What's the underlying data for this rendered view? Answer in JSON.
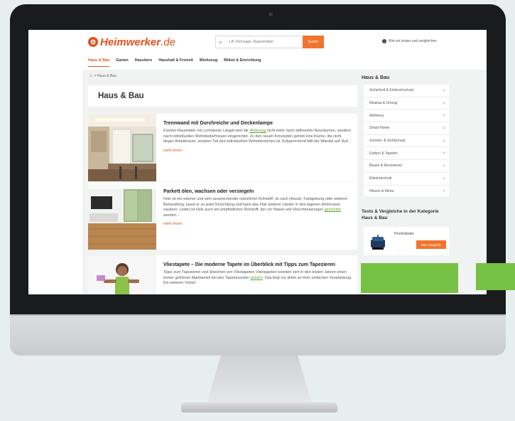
{
  "brand": {
    "name": "Heimwerker",
    "domain": ".de"
  },
  "search": {
    "placeholder": "z.B. Kiichsage, Rasenmäher",
    "button_label": "Suche"
  },
  "header_link": "Wie wir testen und vergleichen",
  "nav": [
    "Haus & Bau",
    "Garten",
    "Haustiere",
    "Haushalt & Freizeit",
    "Werkzeug",
    "Möbel & Einrichtung"
  ],
  "breadcrumb": "> Haus & Bau",
  "page_title": "Haus & Bau",
  "articles": [
    {
      "title": "Trennwand mit Durchreiche und Deckenlampe",
      "excerpt_before": "Küchen-Raumteiler mit Lichtdecke Längst wird die ",
      "excerpt_link": "Wohnung",
      "excerpt_after": " nicht mehr nach definierten Nutzräumen, sondern nach individuellen Wohnbedürfnissen eingerichtet. Zu den neuen Konzepten gehört eine Küche, die nicht länger Arbeitsraum, sondern Teil des individuellen Wohnbereiches ist. Entsprechend fällt der Wandel auf: Auf...",
      "more": "mehr lesen"
    },
    {
      "title": "Parkett ölen, wachsen oder versiegeln",
      "excerpt_before": "Holz ist ein warmer und sehr ansprechender natürlicher Rohstoff. Je nach Holzart, Farbgebung oder weiterer Behandlung, passt er zu jeder Einrichtung und kann das Flair anderer Länder in den eigenen Wohnraum zaubern. Leider ist Holz auch ein empfindlicher Rohstoff, der vor Nässe und Verschmutzungen ",
      "excerpt_link": "geschützt",
      "excerpt_after": " werden...",
      "more": "mehr lesen"
    },
    {
      "title": "Vliestapete – Die moderne Tapete im Überblick mit Tipps zum Tapezieren",
      "excerpt_before": "Tipps zum Tapezieren und Streichen von Vliestapeten Vliestapeten konnten sich in den letzten Jahren einen immer größeren Marktanteil bei den Tapetensorten ",
      "excerpt_link": "sichern",
      "excerpt_after": ". Das liegt vor allem an ihrer einfachen Verarbeitung. Ein weiterer Vorteil",
      "more": ""
    }
  ],
  "sidebar": {
    "title": "Haus & Bau",
    "items": [
      "Sicherheit & Einbruchschutz",
      "Neubau & Umzug",
      "Wellness",
      "Smart-Home",
      "Sonnen- & Sichtschutz",
      "Farben & Tapeten",
      "Bauen & Renovieren",
      "Elektrotechnik",
      "Heizen & Klima"
    ],
    "tests_title": "Tests & Vergleiche in der Kategorie Haus & Bau",
    "product": {
      "name": "Poolroboter",
      "button_label": "Zum Vergleich"
    }
  },
  "colors": {
    "brand": "#e3531f",
    "button": "#f0742f",
    "link_green": "#5a9e2a",
    "accent_green": "#76c043"
  }
}
